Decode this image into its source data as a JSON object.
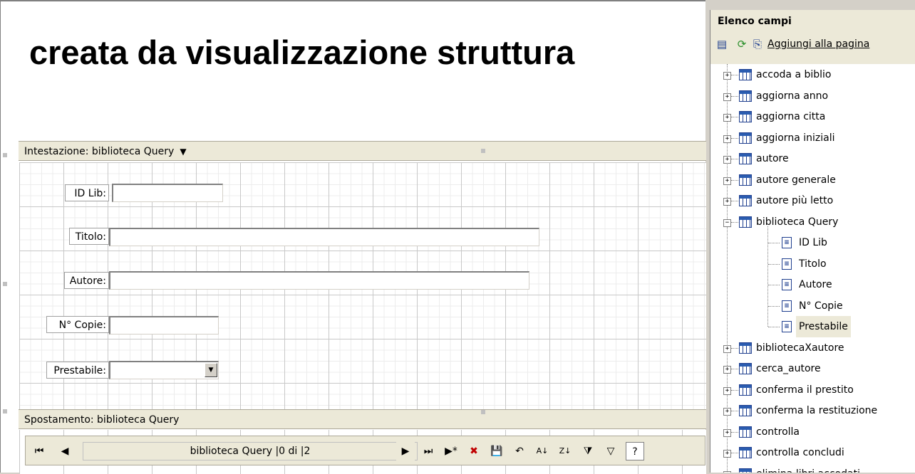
{
  "form": {
    "title": "creata da visualizzazione struttura",
    "header_section": "Intestazione: biblioteca Query",
    "footer_section": "Spostamento: biblioteca Query",
    "fields": [
      {
        "label": "ID Lib:",
        "type": "text"
      },
      {
        "label": "Titolo:",
        "type": "text"
      },
      {
        "label": "Autore:",
        "type": "text"
      },
      {
        "label": "N° Copie:",
        "type": "text"
      },
      {
        "label": "Prestabile:",
        "type": "combo"
      }
    ],
    "navigation": {
      "caption": "biblioteca Query |0 di |2",
      "buttons": [
        "first",
        "prev",
        "next",
        "last",
        "new-record",
        "delete",
        "save",
        "undo",
        "sort-asc",
        "sort-desc",
        "filter-by-selection",
        "apply-filter",
        "help"
      ]
    }
  },
  "field_list": {
    "title": "Elenco campi",
    "add_to_page": "Aggiungi alla pagina",
    "tree": [
      {
        "label": "accoda a biblio",
        "kind": "query",
        "expanded": false
      },
      {
        "label": "aggiorna anno",
        "kind": "query",
        "expanded": false
      },
      {
        "label": "aggiorna citta",
        "kind": "query",
        "expanded": false
      },
      {
        "label": "aggiorna iniziali",
        "kind": "query",
        "expanded": false
      },
      {
        "label": "autore",
        "kind": "query",
        "expanded": false
      },
      {
        "label": "autore generale",
        "kind": "query",
        "expanded": false
      },
      {
        "label": "autore più letto",
        "kind": "query",
        "expanded": false
      },
      {
        "label": "biblioteca Query",
        "kind": "query",
        "expanded": true,
        "children": [
          "ID Lib",
          "Titolo",
          "Autore",
          "N° Copie",
          "Prestabile"
        ],
        "selected_child": "Prestabile"
      },
      {
        "label": "bibliotecaXautore",
        "kind": "query",
        "expanded": false
      },
      {
        "label": "cerca_autore",
        "kind": "query",
        "expanded": false
      },
      {
        "label": "conferma il prestito",
        "kind": "query",
        "expanded": false
      },
      {
        "label": "conferma la restituzione",
        "kind": "query",
        "expanded": false
      },
      {
        "label": "controlla",
        "kind": "query",
        "expanded": false
      },
      {
        "label": "controlla concludi",
        "kind": "query",
        "expanded": false
      },
      {
        "label": "elimina libri accodati",
        "kind": "query",
        "expanded": false
      }
    ]
  },
  "colors": {
    "panel": "#ece9d8",
    "icon_blue": "#1f3f8f"
  }
}
